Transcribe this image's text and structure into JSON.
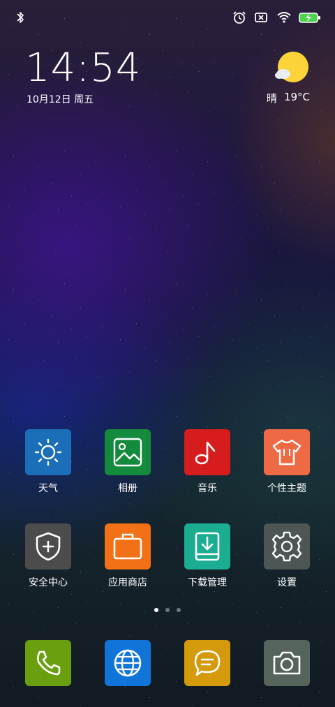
{
  "status_bar": {
    "icons": [
      "bluetooth-icon",
      "alarm-icon",
      "no-sim-icon",
      "wifi-icon",
      "battery-charging-icon"
    ]
  },
  "clock": {
    "time": "14:54",
    "date": "10月12日 周五"
  },
  "weather": {
    "condition": "晴",
    "temperature": "19°C",
    "icon": "sunny-partly-cloudy-icon"
  },
  "apps": {
    "row1": [
      {
        "label": "天气",
        "icon": "sun-icon",
        "color": "#1a6fb8"
      },
      {
        "label": "相册",
        "icon": "gallery-icon",
        "color": "#148a3c"
      },
      {
        "label": "音乐",
        "icon": "music-note-icon",
        "color": "#d61c1c"
      },
      {
        "label": "个性主题",
        "icon": "shirt-icon",
        "color": "#ee6a45"
      }
    ],
    "row2": [
      {
        "label": "安全中心",
        "icon": "shield-plus-icon",
        "color": "#4c4c4c"
      },
      {
        "label": "应用商店",
        "icon": "bag-icon",
        "color": "#f27117"
      },
      {
        "label": "下载管理",
        "icon": "download-icon",
        "color": "#1aad91"
      },
      {
        "label": "设置",
        "icon": "gear-icon",
        "color": "#4e5555"
      }
    ]
  },
  "page_indicator": {
    "pages": 3,
    "active": 1
  },
  "dock": [
    {
      "icon": "phone-icon",
      "color": "#6aa010"
    },
    {
      "icon": "globe-icon",
      "color": "#1174d8"
    },
    {
      "icon": "message-icon",
      "color": "#d59a0b"
    },
    {
      "icon": "camera-icon",
      "color": "#56655c"
    }
  ]
}
